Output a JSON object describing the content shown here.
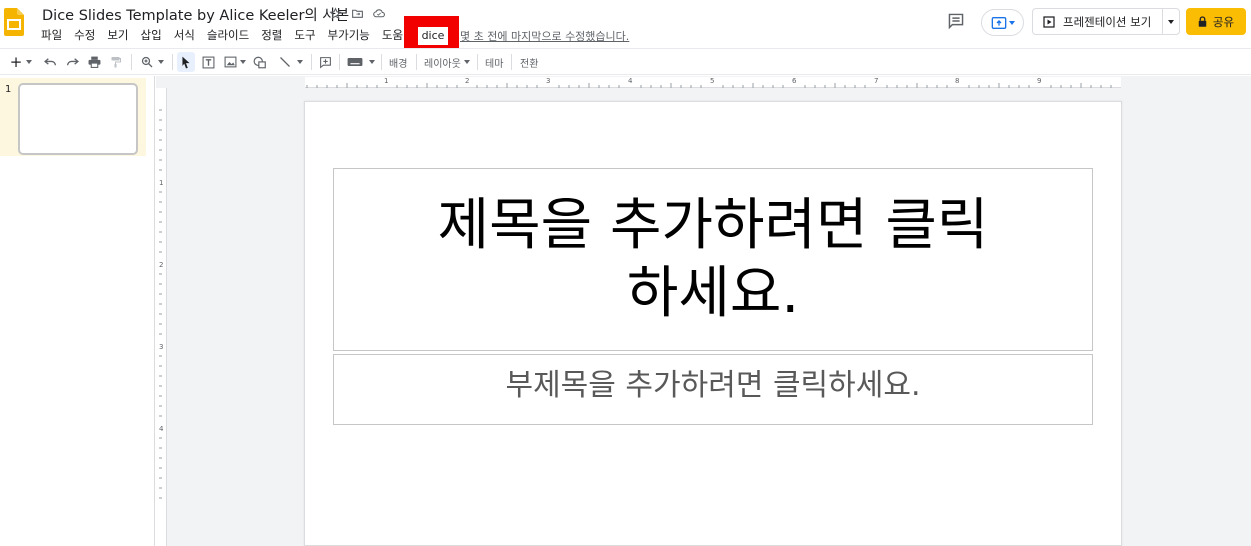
{
  "app": {
    "title": "Dice Slides Template by Alice Keeler의 사본",
    "last_edit": "몇 초 전에 마지막으로 수정했습니다.",
    "brand_color": "#f4b400"
  },
  "menu": {
    "items": [
      "파일",
      "수정",
      "보기",
      "삽입",
      "서식",
      "슬라이드",
      "정렬",
      "도구",
      "부가기능",
      "도움말"
    ],
    "dice": "dice"
  },
  "header": {
    "present_label": "프레젠테이션 보기",
    "share_label": "공유"
  },
  "toolbar": {
    "background": "배경",
    "layout": "레이아웃",
    "theme": "테마",
    "transition": "전환"
  },
  "ruler": {
    "h": [
      "1",
      "2",
      "3",
      "4",
      "5",
      "6",
      "7",
      "8",
      "9"
    ],
    "v": [
      "1",
      "2",
      "3",
      "4"
    ]
  },
  "filmstrip": {
    "slide_number": "1"
  },
  "slide": {
    "title_placeholder": "제목을 추가하려면 클릭하세요.",
    "subtitle_placeholder": "부제목을 추가하려면 클릭하세요."
  },
  "highlight_color": "#f20000",
  "share_color": "#fbbc04"
}
